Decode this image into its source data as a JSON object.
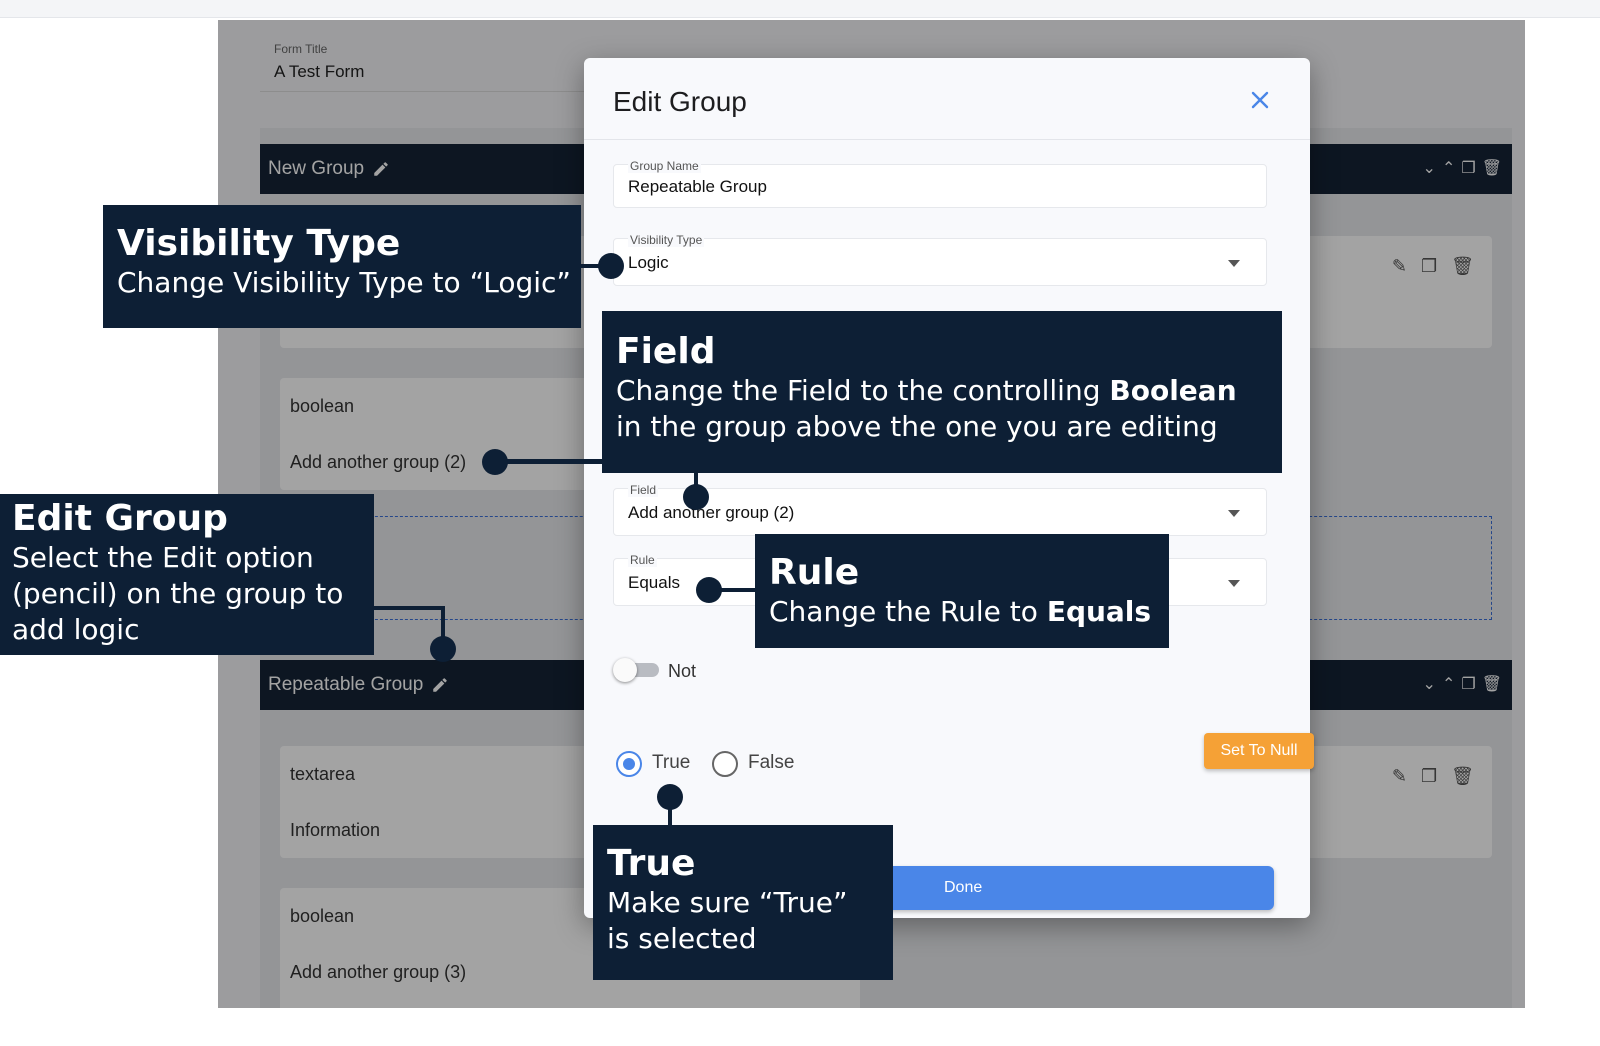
{
  "builder": {
    "form_title_label": "Form Title",
    "form_title_value": "A Test Form",
    "group1_name": "New Group",
    "item_boolean_1": "boolean",
    "item_add_group_2": "Add another group (2)",
    "group2_name": "Repeatable Group",
    "item_textarea": "textarea",
    "item_information": "Information",
    "item_boolean_2": "boolean",
    "item_add_group_3": "Add another group (3)"
  },
  "modal": {
    "title": "Edit Group",
    "group_name_label": "Group Name",
    "group_name_value": "Repeatable Group",
    "visibility_label": "Visibility Type",
    "visibility_value": "Logic",
    "field_label": "Field",
    "field_value": "Add another group (2)",
    "rule_label": "Rule",
    "rule_value": "Equals",
    "not_label": "Not",
    "true_label": "True",
    "false_label": "False",
    "set_null_label": "Set To Null",
    "done_label": "Done"
  },
  "callouts": {
    "visibility_title": "Visibility Type",
    "visibility_body": "Change Visibility Type to “Logic”",
    "field_title": "Field",
    "field_body_1": "Change the Field to the controlling ",
    "field_body_bold": "Boolean",
    "field_body_2": "in the group above the one you are editing",
    "edit_title": "Edit Group",
    "edit_body_1": "Select the Edit option",
    "edit_body_2": "(pencil) on the group to",
    "edit_body_3": "add logic",
    "rule_title": "Rule",
    "rule_body": "Change the Rule to ",
    "rule_body_bold": "Equals",
    "true_title": "True",
    "true_body_1": "Make sure “True”",
    "true_body_2": "is selected"
  },
  "colors": {
    "navy": "#0d1f35",
    "accent_blue": "#4a86e8",
    "orange": "#f5a136"
  }
}
